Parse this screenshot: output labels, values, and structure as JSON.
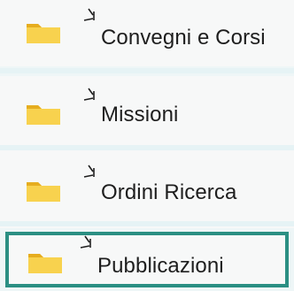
{
  "folders": [
    {
      "label": "Convegni e Corsi",
      "icon": "folder-icon",
      "status_icon": "sync-pending-icon"
    },
    {
      "label": "Missioni",
      "icon": "folder-icon",
      "status_icon": "sync-pending-icon"
    },
    {
      "label": "Ordini Ricerca",
      "icon": "folder-icon",
      "status_icon": "sync-pending-icon"
    },
    {
      "label": "Pubblicazioni",
      "icon": "folder-icon",
      "status_icon": "sync-pending-icon",
      "selected": true
    }
  ],
  "colors": {
    "folder": "#f4c63c",
    "folder_dark": "#e6ad1f",
    "selection_border": "#2b8f83",
    "row_background": "#f7f8f8",
    "divider": "#e6f3f5"
  }
}
